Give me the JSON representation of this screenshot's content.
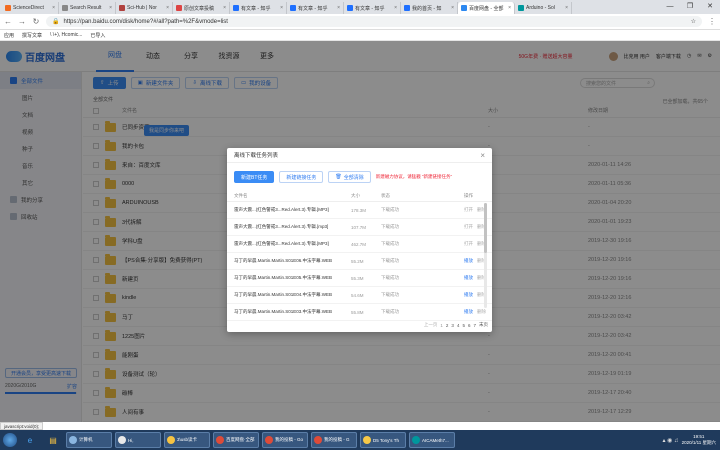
{
  "browser": {
    "tabs": [
      {
        "label": "ScienceDirect",
        "color": "#f26b21"
      },
      {
        "label": "Search Result",
        "color": "#888888"
      },
      {
        "label": "Sci-Hub | Nor",
        "color": "#b0413e"
      },
      {
        "label": "原创文章投稿",
        "color": "#d44"
      },
      {
        "label": "有文章 - 知乎",
        "color": "#1e6fff"
      },
      {
        "label": "有文章 - 知乎",
        "color": "#1e6fff"
      },
      {
        "label": "有文章 - 知乎",
        "color": "#1e6fff"
      },
      {
        "label": "我的首页 - 知",
        "color": "#1e6fff"
      },
      {
        "label": "百度网盘 - 全部",
        "color": "#2c88f0",
        "active": true
      },
      {
        "label": "Arduino - Sol",
        "color": "#00979d"
      }
    ],
    "url": "https://pan.baidu.com/disk/home?#/all?path=%2F&vmode=list",
    "bookmarks": [
      "应用",
      "撰写文章",
      "\\ \\+), Hcomic...",
      "已导入"
    ]
  },
  "header": {
    "logo": "百度网盘",
    "nav": [
      "网盘",
      "动态",
      "分享",
      "找资源",
      "更多"
    ],
    "promo": "50G年费 · 赠送超大容量",
    "username": "比克用 用户",
    "links": [
      "客户端下载",
      "◷",
      "✉",
      "⚙"
    ]
  },
  "sidebar": {
    "items": [
      {
        "label": "全部文件",
        "active": true,
        "sub": false
      },
      {
        "label": "图片",
        "sub": true
      },
      {
        "label": "文档",
        "sub": true
      },
      {
        "label": "视频",
        "sub": true
      },
      {
        "label": "种子",
        "sub": true
      },
      {
        "label": "音乐",
        "sub": true
      },
      {
        "label": "其它",
        "sub": true
      },
      {
        "label": "我的分享",
        "sub": false
      },
      {
        "label": "回收站",
        "sub": false
      }
    ],
    "quota_button": "开通会员，享受更高速下载",
    "quota_used": "2020G/2010G",
    "quota_expand": "扩容",
    "quota_fraction": 0.99
  },
  "toolbar": {
    "upload": "上传",
    "new_folder": "新建文件夹",
    "offline_download": "离线下载",
    "my_devices": "我的设备",
    "search_placeholder": "搜索您的文件"
  },
  "breadcrumb": "全部文件",
  "count_text": "已全部加载，共65个",
  "list_head": {
    "name": "文件名",
    "size": "大小",
    "date": "修改日期"
  },
  "files": [
    {
      "name": "已同步资源",
      "size": "-",
      "date": "-"
    },
    {
      "name": "我的卡包",
      "size": "-",
      "date": "-"
    },
    {
      "name": "来自：百度文库",
      "size": "-",
      "date": "2020-01-11 14:26"
    },
    {
      "name": "0000",
      "size": "-",
      "date": "2020-01-11 05:36"
    },
    {
      "name": "ARDUINOUSB",
      "size": "-",
      "date": "2020-01-04 20:20"
    },
    {
      "name": "3代拆解",
      "size": "-",
      "date": "2020-01-01 19:23"
    },
    {
      "name": "学科U盘",
      "size": "-",
      "date": "2019-12-30 19:16"
    },
    {
      "name": "【PS合集·分享版】免费获得(PT)",
      "size": "-",
      "date": "2019-12-20 19:16"
    },
    {
      "name": "新建页",
      "size": "-",
      "date": "2019-12-20 19:16"
    },
    {
      "name": "kindle",
      "size": "-",
      "date": "2019-12-20 12:16"
    },
    {
      "name": "马丁",
      "size": "-",
      "date": "2019-12-20 03:42"
    },
    {
      "name": "1225图片",
      "size": "-",
      "date": "2019-12-20 03:42"
    },
    {
      "name": "能刚蛋",
      "size": "-",
      "date": "2019-12-20 00:41"
    },
    {
      "name": "设备测试（轮）",
      "size": "-",
      "date": "2019-12-19 01:19"
    },
    {
      "name": "碳棒",
      "size": "-",
      "date": "2019-12-17 20:40"
    },
    {
      "name": "人间有事",
      "size": "-",
      "date": "2019-12-17 12:29"
    }
  ],
  "tooltip": "我是同步你来吧",
  "dialog": {
    "title": "离线下载任务列表",
    "new_task": "新建BT任务",
    "new_link_task": "新建链接任务",
    "clear_all": "全部清除",
    "note": "新建磁力协议，请猛戳 “新建链接任务”",
    "head": {
      "name": "文件名",
      "size": "大小",
      "status": "状态",
      "action": "操作"
    },
    "tasks": [
      {
        "name": "雷声大震...(红色警戒3...Red.Alert.3).专辑.[MP3]",
        "size": "178.3M",
        "status": "下载成功",
        "act1": "打开",
        "act2": "删除",
        "act1_link": false
      },
      {
        "name": "雷声大震...(红色警戒3...Red.Alert.3).专辑.[mp3]",
        "size": "107.7M",
        "status": "下载成功",
        "act1": "打开",
        "act2": "删除",
        "act1_link": false
      },
      {
        "name": "雷声大震...(红色警戒3...Red.Alert.3).专辑.[MP3]",
        "size": "462.7M",
        "status": "下载成功",
        "act1": "打开",
        "act2": "删除",
        "act1_link": false
      },
      {
        "name": "马丁的早晨.Martin.Martin.S01E06.中法字幕.WEB",
        "size": "55.2M",
        "status": "下载成功",
        "act1": "播放",
        "act2": "删除",
        "act1_link": true
      },
      {
        "name": "马丁的早晨.Martin.Martin.S01E05.中法字幕.WEB",
        "size": "55.3M",
        "status": "下载成功",
        "act1": "播放",
        "act2": "删除",
        "act1_link": true
      },
      {
        "name": "马丁的早晨.Martin.Martin.S01E04.中法字幕.WEB",
        "size": "54.6M",
        "status": "下载成功",
        "act1": "播放",
        "act2": "删除",
        "act1_link": true
      },
      {
        "name": "马丁的早晨.Martin.Martin.S01E03.中法字幕.WEB",
        "size": "55.8M",
        "status": "下载成功",
        "act1": "播放",
        "act2": "删除",
        "act1_link": true
      }
    ],
    "pager": {
      "prev": "上一页",
      "pages": [
        "1",
        "2",
        "3",
        "4",
        "5",
        "6",
        "7"
      ],
      "current": "1",
      "next": "末页"
    }
  },
  "status_url": "javascript:void(0);",
  "taskbar": {
    "windows": [
      {
        "label": "计算机",
        "color": "#8bb6e0"
      },
      {
        "label": "Hi,",
        "color": "#e9e9e9"
      },
      {
        "label": "3\\usb读卡",
        "color": "#f6c342"
      },
      {
        "label": "百度网盘·全部",
        "color": "#dd4b39"
      },
      {
        "label": "我的投稿 - Go",
        "color": "#dd4b39"
      },
      {
        "label": "我的投稿 - G",
        "color": "#dd4b39"
      },
      {
        "label": "D5 Tony's Th",
        "color": "#f7c948"
      },
      {
        "label": "AICAMeth7...",
        "color": "#00979d"
      }
    ],
    "time": "19:51",
    "date": "2020/1/11 星期六"
  }
}
